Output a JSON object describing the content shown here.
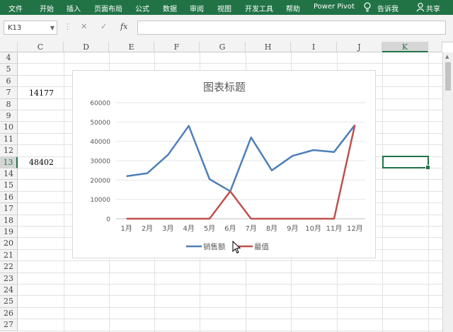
{
  "ribbon": {
    "tabs": [
      "文件",
      "开始",
      "插入",
      "页面布局",
      "公式",
      "数据",
      "审阅",
      "视图",
      "开发工具",
      "帮助",
      "Power Pivot"
    ],
    "tell_me": "告诉我",
    "share": "共享"
  },
  "formula_bar": {
    "name_box": "K13",
    "cancel": "✕",
    "enter": "✓",
    "fx": "fx",
    "formula": ""
  },
  "columns": [
    "C",
    "D",
    "E",
    "F",
    "G",
    "H",
    "I",
    "J",
    "K"
  ],
  "selected_column": "K",
  "rows": [
    "4",
    "5",
    "6",
    "7",
    "8",
    "9",
    "10",
    "11",
    "12",
    "13",
    "14",
    "15",
    "16",
    "17",
    "18",
    "19",
    "20",
    "21",
    "22",
    "23",
    "24",
    "25",
    "26",
    "27"
  ],
  "selected_row": "13",
  "cells": {
    "c7": "14177",
    "c13": "48402"
  },
  "colors": {
    "excel_green": "#217346",
    "series1": "#4e7fba",
    "series2": "#c0504d"
  },
  "chart_data": {
    "type": "line",
    "title": "图表标题",
    "categories": [
      "1月",
      "2月",
      "3月",
      "4月",
      "5月",
      "6月",
      "7月",
      "8月",
      "9月",
      "10月",
      "11月",
      "12月"
    ],
    "series": [
      {
        "name": "销售额",
        "values": [
          22000,
          23500,
          33000,
          48000,
          20500,
          14177,
          42000,
          25000,
          32500,
          35500,
          34500,
          48402
        ]
      },
      {
        "name": "最值",
        "values": [
          0,
          0,
          0,
          0,
          0,
          14177,
          0,
          0,
          0,
          0,
          0,
          48402
        ]
      }
    ],
    "ylim": [
      0,
      60000
    ],
    "yticks": [
      "0",
      "10000",
      "20000",
      "30000",
      "40000",
      "50000",
      "60000"
    ],
    "grid": true,
    "legend_position": "bottom"
  }
}
